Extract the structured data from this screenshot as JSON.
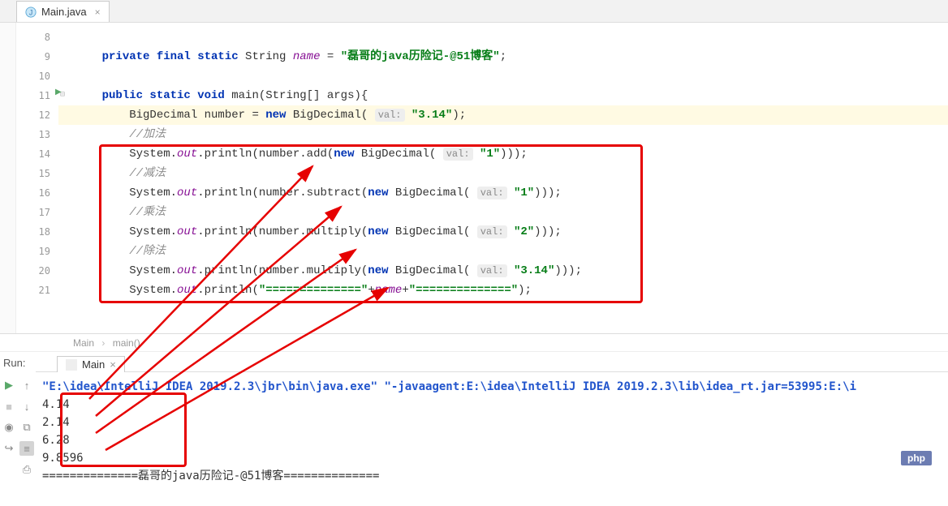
{
  "tab": {
    "filename": "Main.java",
    "close": "×"
  },
  "gutter": [
    "8",
    "9",
    "10",
    "11",
    "12",
    "13",
    "14",
    "15",
    "16",
    "17",
    "18",
    "19",
    "20",
    "21"
  ],
  "code": {
    "l9_kw1": "private final static",
    "l9_type": " String ",
    "l9_field": "name",
    "l9_eq": " = ",
    "l9_str": "\"磊哥的java历险记-@51博客\"",
    "l9_end": ";",
    "l11_kw": "public static void",
    "l11_rest": " main(String[] args){",
    "l12_a": "BigDecimal number = ",
    "l12_kw": "new",
    "l12_b": " BigDecimal( ",
    "l12_hint": "val:",
    "l12_str": "\"3.14\"",
    "l12_end": ");",
    "l13_c": "//加法",
    "l14_a": "System.",
    "l14_out": "out",
    "l14_b": ".println(number.add(",
    "l14_kw": "new",
    "l14_c": " BigDecimal( ",
    "l14_hint": "val:",
    "l14_str": "\"1\"",
    "l14_end": ")));",
    "l15_c": "//减法",
    "l16_a": "System.",
    "l16_out": "out",
    "l16_b": ".println(number.subtract(",
    "l16_kw": "new",
    "l16_c": " BigDecimal( ",
    "l16_hint": "val:",
    "l16_str": "\"1\"",
    "l16_end": ")));",
    "l17_c": "//乘法",
    "l18_a": "System.",
    "l18_out": "out",
    "l18_b": ".println(number.multiply(",
    "l18_kw": "new",
    "l18_c": " BigDecimal( ",
    "l18_hint": "val:",
    "l18_str": "\"2\"",
    "l18_end": ")));",
    "l19_c": "//除法",
    "l20_a": "System.",
    "l20_out": "out",
    "l20_b": ".println(number.multiply(",
    "l20_kw": "new",
    "l20_c": " BigDecimal( ",
    "l20_hint": "val:",
    "l20_str": "\"3.14\"",
    "l20_end": ")));",
    "l21_a": "System.",
    "l21_out": "out",
    "l21_b": ".println(",
    "l21_str1": "\"==============\"",
    "l21_plus1": "+",
    "l21_field": "name",
    "l21_plus2": "+",
    "l21_str2": "\"==============\"",
    "l21_end": ");"
  },
  "breadcrumb": {
    "a": "Main",
    "b": "main()"
  },
  "run": {
    "label": "Run:",
    "tab": "Main",
    "tab_close": "×",
    "cmd_a": "\"E:\\idea\\IntelliJ IDEA 2019.2.3\\jbr\\bin\\java.exe\"",
    "cmd_b": " \"-javaagent:E:\\idea\\IntelliJ IDEA 2019.2.3\\lib\\idea_rt.jar=53995:E:\\i",
    "out1": "4.14",
    "out2": "2.14",
    "out3": "6.28",
    "out4": "9.8596",
    "out5": "==============磊哥的java历险记-@51博客=============="
  },
  "badge": "php"
}
